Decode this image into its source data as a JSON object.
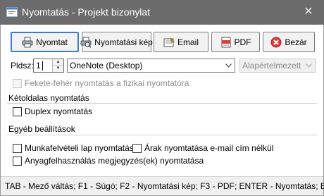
{
  "window": {
    "title": "Nyomtatás - Projekt bizonylat"
  },
  "toolbar": {
    "print_label": "Nyomtat",
    "print_preview_label": "Nyomtatási kép",
    "email_label": "Email",
    "pdf_label": "PDF",
    "close_label": "Bezár"
  },
  "printer": {
    "copies_label": "Pldsz:",
    "copies_value": "1",
    "printer_selected": "OneNote (Desktop)",
    "tray_selected": "Alapértelmezett"
  },
  "options": {
    "bw_print_label": "Fekete-fehér nyomtatás a fizikai nyomtatóra",
    "duplex_group_title": "Kétoldalas nyomtatás",
    "duplex_label": "Duplex nyomtatás",
    "other_group_title": "Egyéb beállítások",
    "worksheet_label": "Munkafelvételi lap nyomtatása",
    "prices_label": "Árak nyomtatása e-mail cím nélkül",
    "materials_label": "Anyagfelhasználás megjegyzés(ek) nyomtatása"
  },
  "status": {
    "text": "TAB - Mező váltás; F1 - Súgó; F2 - Nyomtatási kép; F3 - PDF; ENTER - Nyomtatás; ESC"
  },
  "colors": {
    "titlebar": "#6c6c6c",
    "button_bg": "#f2f2f2",
    "focus_border": "#3b7bd4",
    "close_icon_red": "#e03a3a"
  }
}
